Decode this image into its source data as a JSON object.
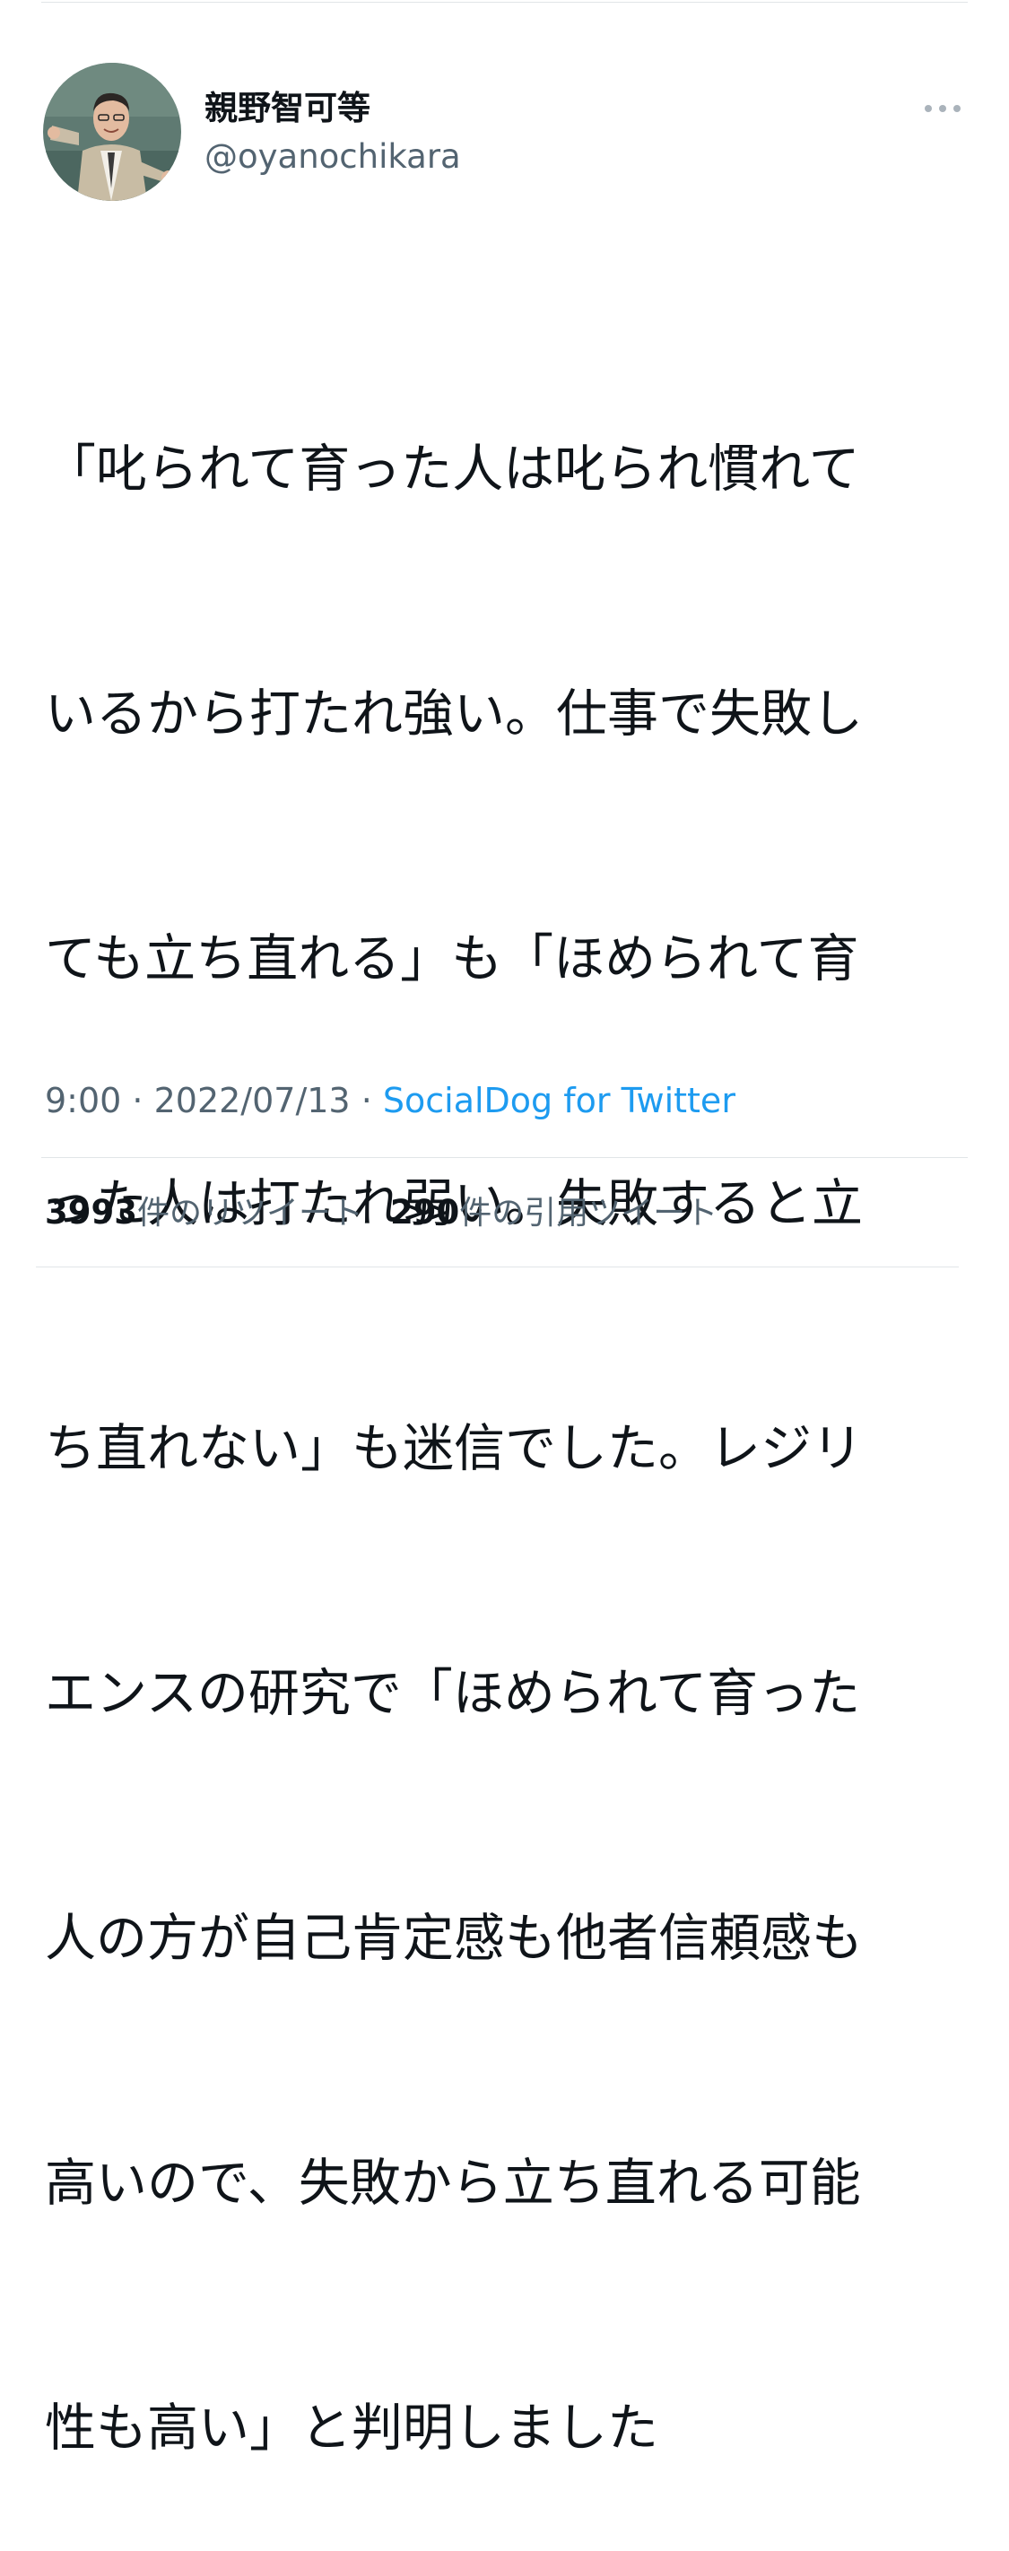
{
  "tweet": {
    "author": {
      "display_name": "親野智可等",
      "handle": "@oyanochikara",
      "avatar_icon": "profile-photo"
    },
    "more_icon": "more-horizontal-icon",
    "text_lines": [
      "「叱られて育った人は叱られ慣れて",
      "いるから打たれ強い。仕事で失敗し",
      "ても立ち直れる」も「ほめられて育",
      "った人は打たれ弱い。失敗すると立",
      "ち直れない」も迷信でした。レジリ",
      "エンスの研究で「ほめられて育った",
      "人の方が自己肯定感も他者信頼感も",
      "高いので、失敗から立ち直れる可能",
      "性も高い」と判明しました"
    ],
    "time": "9:00",
    "separator": " · ",
    "date": "2022/07/13",
    "source": "SocialDog for Twitter"
  },
  "stats": {
    "retweets_count": "3993",
    "retweets_label": "件のリツイート",
    "quotes_count": "290",
    "quotes_label": "件の引用ツイート"
  },
  "colors": {
    "text": "#0f1419",
    "secondary": "#536471",
    "link": "#1d9bf0",
    "divider": "#e1e5e8"
  }
}
